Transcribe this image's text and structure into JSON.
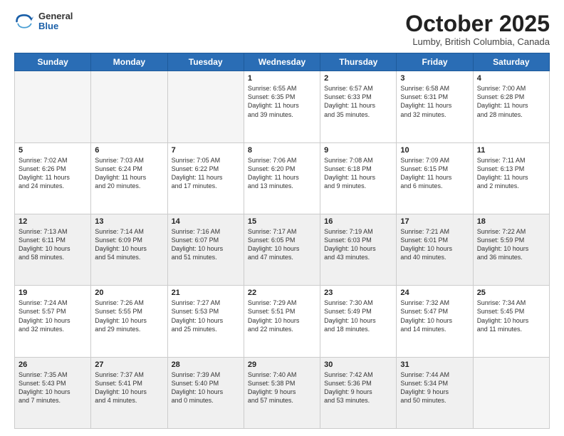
{
  "header": {
    "logo_general": "General",
    "logo_blue": "Blue",
    "month_title": "October 2025",
    "location": "Lumby, British Columbia, Canada"
  },
  "weekdays": [
    "Sunday",
    "Monday",
    "Tuesday",
    "Wednesday",
    "Thursday",
    "Friday",
    "Saturday"
  ],
  "weeks": [
    [
      {
        "day": "",
        "info": "",
        "shaded": true
      },
      {
        "day": "",
        "info": "",
        "shaded": true
      },
      {
        "day": "",
        "info": "",
        "shaded": true
      },
      {
        "day": "1",
        "info": "Sunrise: 6:55 AM\nSunset: 6:35 PM\nDaylight: 11 hours\nand 39 minutes."
      },
      {
        "day": "2",
        "info": "Sunrise: 6:57 AM\nSunset: 6:33 PM\nDaylight: 11 hours\nand 35 minutes."
      },
      {
        "day": "3",
        "info": "Sunrise: 6:58 AM\nSunset: 6:31 PM\nDaylight: 11 hours\nand 32 minutes."
      },
      {
        "day": "4",
        "info": "Sunrise: 7:00 AM\nSunset: 6:28 PM\nDaylight: 11 hours\nand 28 minutes."
      }
    ],
    [
      {
        "day": "5",
        "info": "Sunrise: 7:02 AM\nSunset: 6:26 PM\nDaylight: 11 hours\nand 24 minutes."
      },
      {
        "day": "6",
        "info": "Sunrise: 7:03 AM\nSunset: 6:24 PM\nDaylight: 11 hours\nand 20 minutes."
      },
      {
        "day": "7",
        "info": "Sunrise: 7:05 AM\nSunset: 6:22 PM\nDaylight: 11 hours\nand 17 minutes."
      },
      {
        "day": "8",
        "info": "Sunrise: 7:06 AM\nSunset: 6:20 PM\nDaylight: 11 hours\nand 13 minutes."
      },
      {
        "day": "9",
        "info": "Sunrise: 7:08 AM\nSunset: 6:18 PM\nDaylight: 11 hours\nand 9 minutes."
      },
      {
        "day": "10",
        "info": "Sunrise: 7:09 AM\nSunset: 6:15 PM\nDaylight: 11 hours\nand 6 minutes."
      },
      {
        "day": "11",
        "info": "Sunrise: 7:11 AM\nSunset: 6:13 PM\nDaylight: 11 hours\nand 2 minutes."
      }
    ],
    [
      {
        "day": "12",
        "info": "Sunrise: 7:13 AM\nSunset: 6:11 PM\nDaylight: 10 hours\nand 58 minutes.",
        "shaded": true
      },
      {
        "day": "13",
        "info": "Sunrise: 7:14 AM\nSunset: 6:09 PM\nDaylight: 10 hours\nand 54 minutes.",
        "shaded": true
      },
      {
        "day": "14",
        "info": "Sunrise: 7:16 AM\nSunset: 6:07 PM\nDaylight: 10 hours\nand 51 minutes.",
        "shaded": true
      },
      {
        "day": "15",
        "info": "Sunrise: 7:17 AM\nSunset: 6:05 PM\nDaylight: 10 hours\nand 47 minutes.",
        "shaded": true
      },
      {
        "day": "16",
        "info": "Sunrise: 7:19 AM\nSunset: 6:03 PM\nDaylight: 10 hours\nand 43 minutes.",
        "shaded": true
      },
      {
        "day": "17",
        "info": "Sunrise: 7:21 AM\nSunset: 6:01 PM\nDaylight: 10 hours\nand 40 minutes.",
        "shaded": true
      },
      {
        "day": "18",
        "info": "Sunrise: 7:22 AM\nSunset: 5:59 PM\nDaylight: 10 hours\nand 36 minutes.",
        "shaded": true
      }
    ],
    [
      {
        "day": "19",
        "info": "Sunrise: 7:24 AM\nSunset: 5:57 PM\nDaylight: 10 hours\nand 32 minutes."
      },
      {
        "day": "20",
        "info": "Sunrise: 7:26 AM\nSunset: 5:55 PM\nDaylight: 10 hours\nand 29 minutes."
      },
      {
        "day": "21",
        "info": "Sunrise: 7:27 AM\nSunset: 5:53 PM\nDaylight: 10 hours\nand 25 minutes."
      },
      {
        "day": "22",
        "info": "Sunrise: 7:29 AM\nSunset: 5:51 PM\nDaylight: 10 hours\nand 22 minutes."
      },
      {
        "day": "23",
        "info": "Sunrise: 7:30 AM\nSunset: 5:49 PM\nDaylight: 10 hours\nand 18 minutes."
      },
      {
        "day": "24",
        "info": "Sunrise: 7:32 AM\nSunset: 5:47 PM\nDaylight: 10 hours\nand 14 minutes."
      },
      {
        "day": "25",
        "info": "Sunrise: 7:34 AM\nSunset: 5:45 PM\nDaylight: 10 hours\nand 11 minutes."
      }
    ],
    [
      {
        "day": "26",
        "info": "Sunrise: 7:35 AM\nSunset: 5:43 PM\nDaylight: 10 hours\nand 7 minutes.",
        "shaded": true
      },
      {
        "day": "27",
        "info": "Sunrise: 7:37 AM\nSunset: 5:41 PM\nDaylight: 10 hours\nand 4 minutes.",
        "shaded": true
      },
      {
        "day": "28",
        "info": "Sunrise: 7:39 AM\nSunset: 5:40 PM\nDaylight: 10 hours\nand 0 minutes.",
        "shaded": true
      },
      {
        "day": "29",
        "info": "Sunrise: 7:40 AM\nSunset: 5:38 PM\nDaylight: 9 hours\nand 57 minutes.",
        "shaded": true
      },
      {
        "day": "30",
        "info": "Sunrise: 7:42 AM\nSunset: 5:36 PM\nDaylight: 9 hours\nand 53 minutes.",
        "shaded": true
      },
      {
        "day": "31",
        "info": "Sunrise: 7:44 AM\nSunset: 5:34 PM\nDaylight: 9 hours\nand 50 minutes.",
        "shaded": true
      },
      {
        "day": "",
        "info": "",
        "shaded": true
      }
    ]
  ]
}
